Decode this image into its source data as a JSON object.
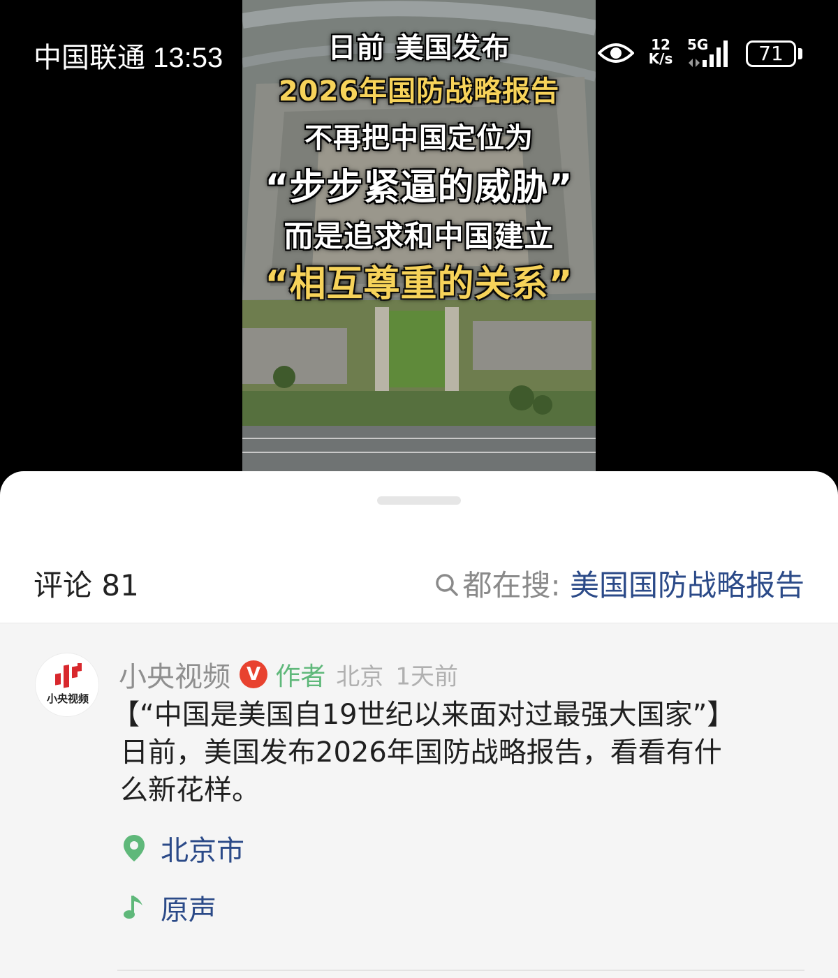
{
  "status_bar": {
    "carrier_time": "中国联通 13:53",
    "net_speed_value": "12",
    "net_speed_unit": "K/s",
    "network_type": "5G",
    "battery": "71"
  },
  "video": {
    "captions": [
      "日前 美国发布",
      "2026年国防战略报告",
      "不再把中国定位为",
      "“步步紧逼的威胁”",
      "而是追求和中国建立",
      "“相互尊重的关系”"
    ]
  },
  "comments_header": {
    "count_label": "评论 81",
    "search_prefix": "都在搜:",
    "search_term": "美国国防战略报告"
  },
  "comment": {
    "avatar_text": "小央视频",
    "author": "小央视频",
    "verified_badge": "V",
    "author_tag": "作者",
    "location": "北京",
    "time": "1天前",
    "body_line1": "【“中国是美国自19世纪以来面对过最强大国家”】",
    "body_line2": "日前，美国发布2026年国防战略报告，看看有什",
    "body_line3": "么新花样。",
    "location_tag": "北京市",
    "sound_tag": "原声"
  },
  "colors": {
    "link_blue": "#2b4a88",
    "author_green": "#5fb87a",
    "caption_yellow": "#f7d35a",
    "verified_red": "#e8422f"
  }
}
